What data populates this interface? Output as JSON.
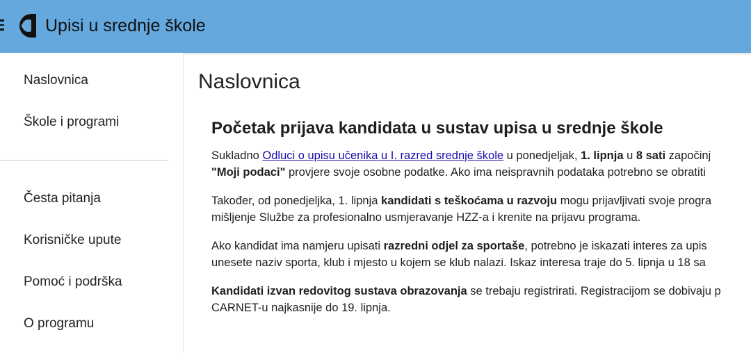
{
  "header": {
    "title": "Upisi u srednje škole",
    "menu_icon": "hamburger-menu-icon",
    "logo": "carnet-logo",
    "background_color": "#64a8de"
  },
  "sidebar": {
    "primary": [
      {
        "label": "Naslovnica"
      },
      {
        "label": "Škole i programi"
      }
    ],
    "secondary": [
      {
        "label": "Česta pitanja"
      },
      {
        "label": "Korisničke upute"
      },
      {
        "label": "Pomoć i podrška"
      },
      {
        "label": "O programu"
      }
    ]
  },
  "main": {
    "page_title": "Naslovnica",
    "article": {
      "heading": "Početak prijava kandidata u sustav upisa u srednje škole",
      "p1": {
        "l1_pre": "Sukladno ",
        "l1_link": "Odluci o upisu učenika u I. razred srednje škole",
        "l1_mid": " u ponedjeljak, ",
        "l1_b1": "1. lipnja",
        "l1_mid2": " u ",
        "l1_b2": "8 sati",
        "l1_post": " započinj",
        "l2_b": "\"Moji podaci\"",
        "l2_post": " provjere svoje osobne podatke. Ako ima neispravnih podataka potrebno se obratiti"
      },
      "p2": {
        "l1_pre": "Također, od ponedjeljka, 1. lipnja ",
        "l1_b": "kandidati s teškoćama u razvoju",
        "l1_post": " mogu prijavljivati svoje progra",
        "l2": "mišljenje Službe za profesionalno usmjeravanje HZZ-a i krenite na prijavu programa."
      },
      "p3": {
        "l1_pre": "Ako kandidat ima namjeru upisati ",
        "l1_b": "razredni odjel za sportaše",
        "l1_post": ", potrebno je iskazati interes za upis",
        "l2": "unesete naziv sporta, klub i mjesto u kojem se klub nalazi. Iskaz interesa traje do 5. lipnja u 18 sa"
      },
      "p4": {
        "l1_b": "Kandidati izvan redovitog sustava obrazovanja",
        "l1_post": " se trebaju registrirati. Registracijom se dobivaju p",
        "l2": "CARNET-u najkasnije do 19. lipnja."
      }
    }
  }
}
